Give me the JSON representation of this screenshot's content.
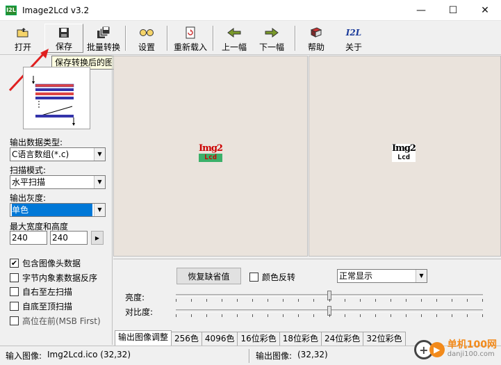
{
  "window": {
    "title": "Image2Lcd v3.2",
    "app_icon_text": "I2L",
    "minimize": "—",
    "maximize": "☐",
    "close": "✕"
  },
  "toolbar": {
    "items": [
      {
        "label": "打开",
        "icon": "open-folder-icon"
      },
      {
        "label": "保存",
        "icon": "save-disk-icon"
      },
      {
        "label": "批量转换",
        "icon": "batch-convert-icon"
      },
      {
        "label": "设置",
        "icon": "settings-glasses-icon"
      },
      {
        "label": "重新载入",
        "icon": "reload-icon"
      },
      {
        "label": "上一幅",
        "icon": "arrow-left-icon"
      },
      {
        "label": "下一幅",
        "icon": "arrow-right-icon"
      },
      {
        "label": "帮助",
        "icon": "help-book-icon"
      },
      {
        "label": "关于",
        "icon": "about-i2l-icon",
        "icon_text": "I2L"
      }
    ],
    "tooltip": "保存转换后的图像文件"
  },
  "left_panel": {
    "output_type_label": "输出数据类型:",
    "output_type_value": "C语言数组(*.c)",
    "scan_mode_label": "扫描模式:",
    "scan_mode_value": "水平扫描",
    "gray_label": "输出灰度:",
    "gray_value": "单色",
    "size_label": "最大宽度和高度",
    "width_value": "240",
    "height_value": "240",
    "checkboxes": [
      {
        "label": "包含图像头数据",
        "checked": true
      },
      {
        "label": "字节内象素数据反序",
        "checked": false
      },
      {
        "label": "自右至左扫描",
        "checked": false
      },
      {
        "label": "自底至顶扫描",
        "checked": false
      },
      {
        "label": "高位在前(MSB First)",
        "checked": false
      }
    ]
  },
  "preview": {
    "input_logo_line1": "Img2",
    "input_logo_line2": "Lcd",
    "output_logo_line1": "Img2",
    "output_logo_line2": "Lcd"
  },
  "adjust": {
    "restore_button": "恢复缺省值",
    "invert_label": "颜色反转",
    "invert_checked": false,
    "display_mode": "正常显示",
    "brightness_label": "亮度:",
    "contrast_label": "对比度:",
    "brightness_level": 0.5,
    "contrast_level": 0.5,
    "tabs": [
      "输出图像调整",
      "256色",
      "4096色",
      "16位彩色",
      "18位彩色",
      "24位彩色",
      "32位彩色"
    ]
  },
  "status": {
    "input_label": "输入图像:",
    "input_value": "Img2Lcd.ico (32,32)",
    "output_label": "输出图像:",
    "output_value": "(32,32)"
  },
  "watermark": {
    "site_name": "单机100网",
    "site_url": "danji100.com"
  },
  "colors": {
    "selection": "#0078d7",
    "preview_bg": "#eae3dc",
    "arrow": "#e02020",
    "tooltip_bg": "#ffffe1"
  }
}
